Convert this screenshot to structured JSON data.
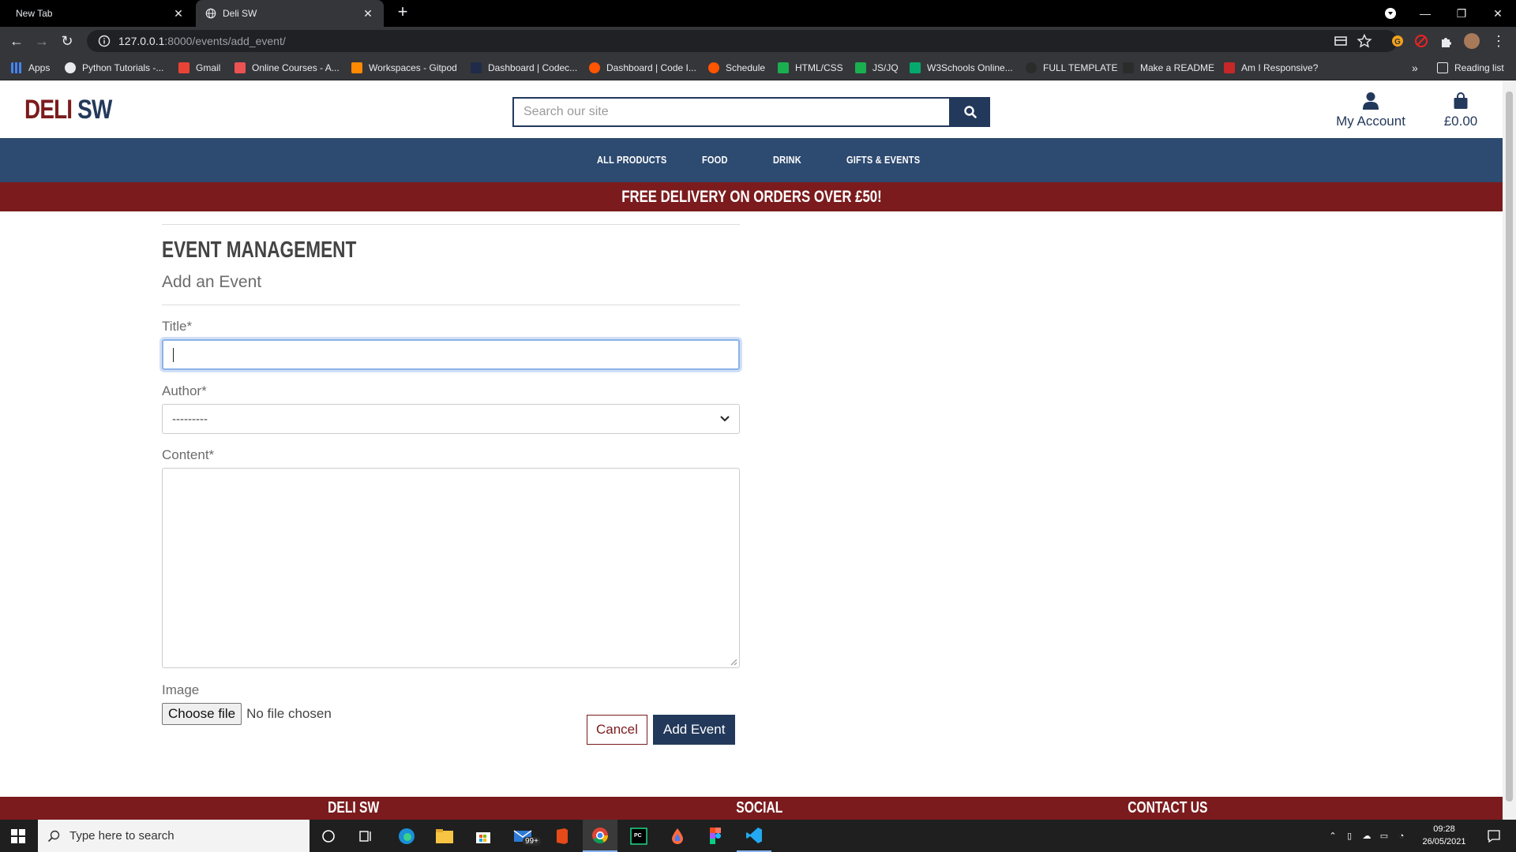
{
  "browser": {
    "tabs": [
      {
        "title": "New Tab",
        "active": false
      },
      {
        "title": "Deli SW",
        "active": true
      }
    ],
    "url_host": "127.0.0.1",
    "url_path": ":8000/events/add_event/",
    "bookmarks": [
      "Apps",
      "Python Tutorials -...",
      "Gmail",
      "Online Courses - A...",
      "Workspaces - Gitpod",
      "Dashboard | Codec...",
      "Dashboard | Code I...",
      "Schedule",
      "HTML/CSS",
      "JS/JQ",
      "W3Schools Online...",
      "FULL TEMPLATE",
      "Make a README",
      "Am I Responsive?"
    ],
    "overflow": "»",
    "reading_list": "Reading list"
  },
  "site": {
    "logo_part1": "DELI",
    "logo_part2": "SW",
    "search_placeholder": "Search our site",
    "account_label": "My Account",
    "bag_total": "£0.00",
    "nav": [
      "All Products",
      "Food",
      "Drink",
      "Gifts & Events"
    ],
    "banner": "FREE DELIVERY ON ORDERS OVER £50!"
  },
  "form": {
    "page_title": "Event Management",
    "subtitle": "Add an Event",
    "title_label": "Title*",
    "title_value": "",
    "author_label": "Author*",
    "author_selected": "---------",
    "content_label": "Content*",
    "content_value": "",
    "image_label": "Image",
    "choose_file": "Choose file",
    "no_file": "No file chosen",
    "cancel": "Cancel",
    "submit": "Add Event"
  },
  "footer": {
    "col1": "Deli SW",
    "col2": "Social",
    "col3": "Contact Us"
  },
  "taskbar": {
    "search_placeholder": "Type here to search",
    "time": "09:28",
    "date": "26/05/2021",
    "mail_badge": "99+"
  },
  "colors": {
    "brand_red": "#7b1b1d",
    "brand_navy": "#23395b",
    "nav_blue": "#2d4a70"
  }
}
